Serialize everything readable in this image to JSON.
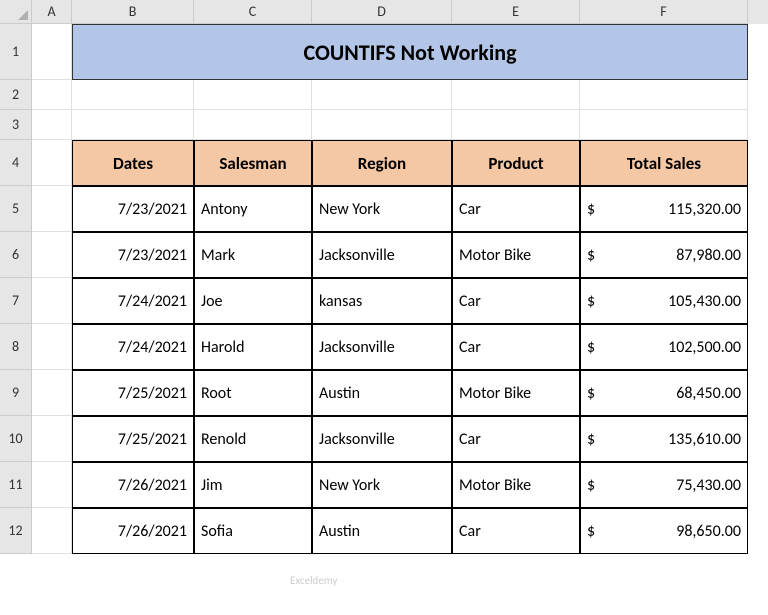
{
  "columns": [
    "A",
    "B",
    "C",
    "D",
    "E",
    "F"
  ],
  "rows": [
    "1",
    "2",
    "3",
    "4",
    "5",
    "6",
    "7",
    "8",
    "9",
    "10",
    "11",
    "12"
  ],
  "title": "COUNTIFS Not Working",
  "headers": {
    "dates": "Dates",
    "salesman": "Salesman",
    "region": "Region",
    "product": "Product",
    "total_sales": "Total Sales"
  },
  "data": [
    {
      "date": "7/23/2021",
      "salesman": "Antony",
      "region": "New York",
      "product": "Car",
      "sales_l": "$",
      "sales_r": "115,320.00"
    },
    {
      "date": "7/23/2021",
      "salesman": "Mark",
      "region": "Jacksonville",
      "product": "Motor Bike",
      "sales_l": "$",
      "sales_r": "87,980.00"
    },
    {
      "date": "7/24/2021",
      "salesman": "Joe",
      "region": "kansas",
      "product": "Car",
      "sales_l": "$",
      "sales_r": "105,430.00"
    },
    {
      "date": "7/24/2021",
      "salesman": "Harold",
      "region": "Jacksonville",
      "product": "Car",
      "sales_l": "$",
      "sales_r": "102,500.00"
    },
    {
      "date": "7/25/2021",
      "salesman": "Root",
      "region": "Austin",
      "product": "Motor Bike",
      "sales_l": "$",
      "sales_r": "68,450.00"
    },
    {
      "date": "7/25/2021",
      "salesman": "Renold",
      "region": "Jacksonville",
      "product": "Car",
      "sales_l": "$",
      "sales_r": "135,610.00"
    },
    {
      "date": "7/26/2021",
      "salesman": "Jim",
      "region": "New York",
      "product": "Motor Bike",
      "sales_l": "$",
      "sales_r": "75,430.00"
    },
    {
      "date": "7/26/2021",
      "salesman": "Sofia",
      "region": "Austin",
      "product": "Car",
      "sales_l": "$",
      "sales_r": "98,650.00"
    }
  ],
  "watermark": "Exceldemy"
}
